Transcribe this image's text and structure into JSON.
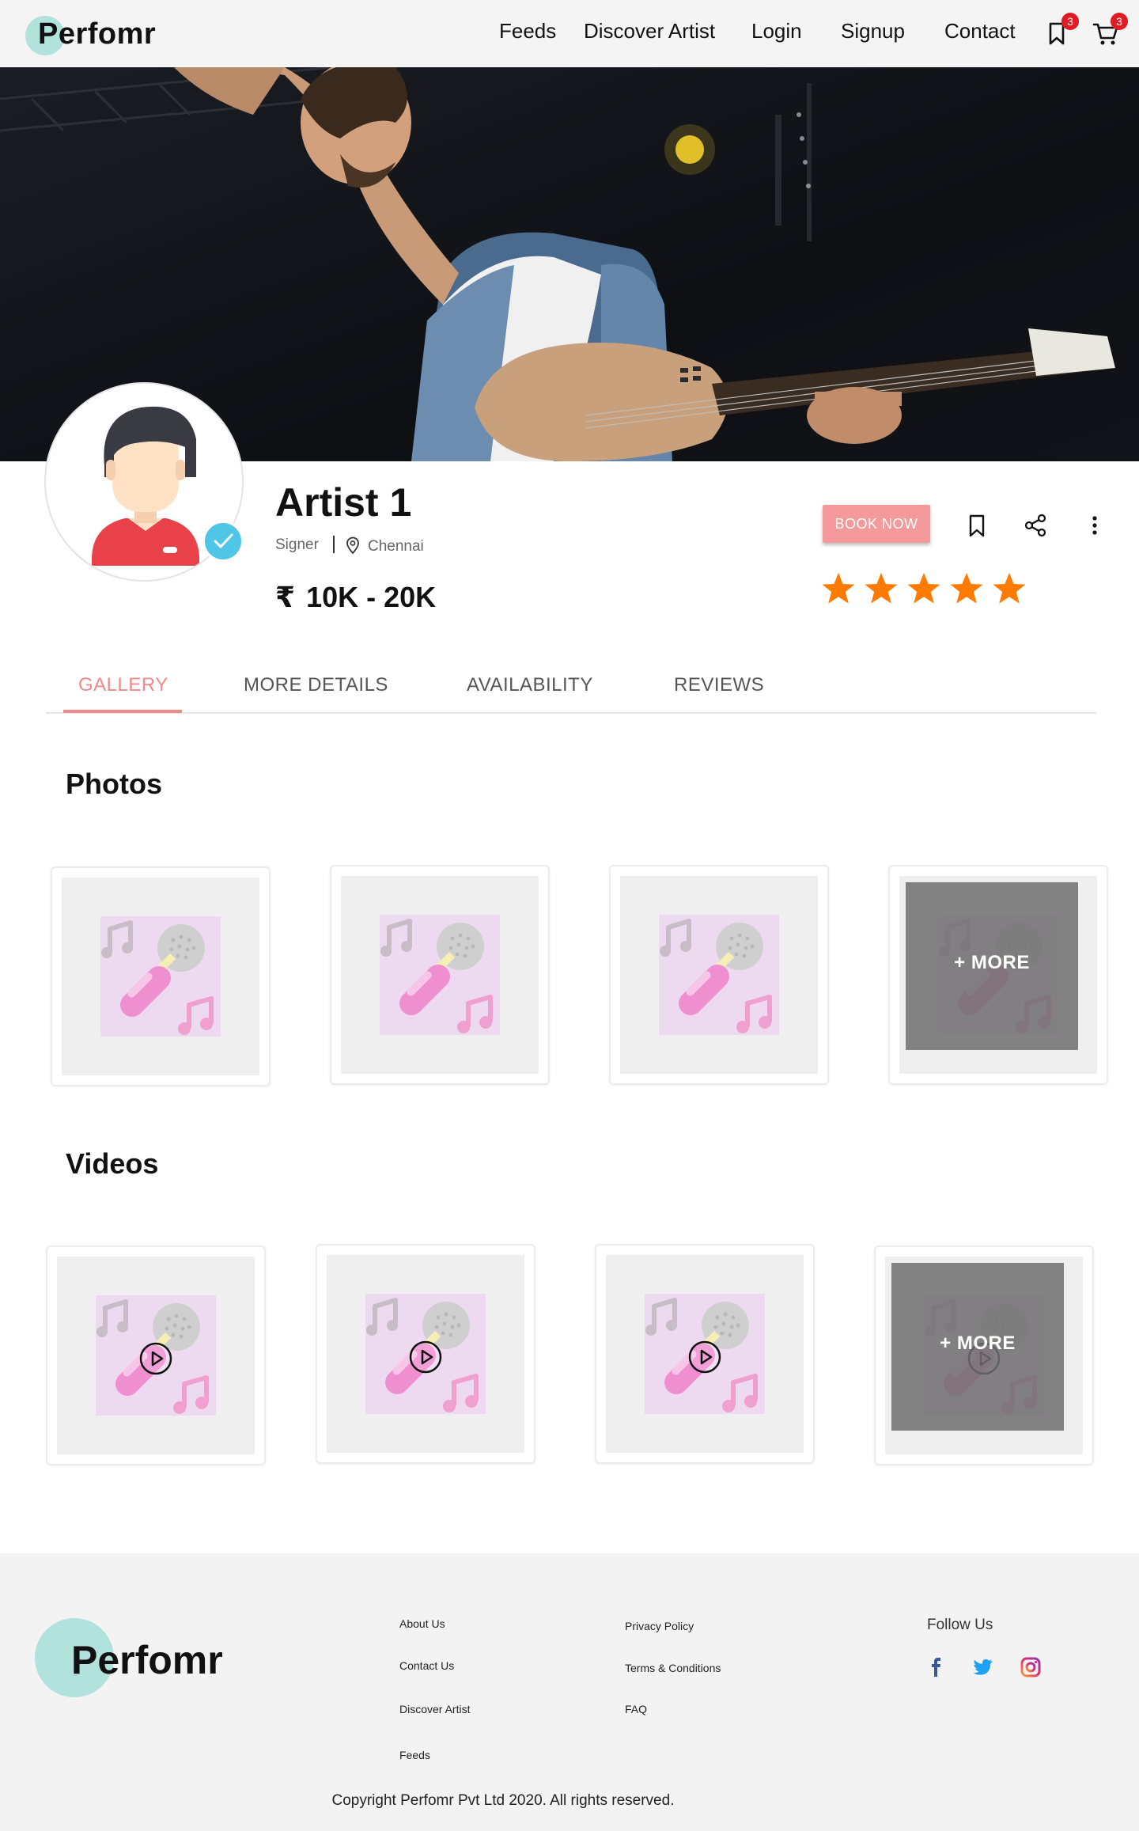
{
  "header": {
    "logo": "Perfomr",
    "nav": [
      "Feeds",
      "Discover Artist",
      "Login",
      "Signup",
      "Contact"
    ],
    "bookmark_count": "3",
    "cart_count": "3",
    "icons": [
      "bookmark-icon",
      "cart-icon"
    ]
  },
  "profile": {
    "name": "Artist 1",
    "role": "Signer",
    "city": "Chennai",
    "price": "10K - 20K",
    "currency_symbol": "₹",
    "rating": 5,
    "rating_max": 5,
    "book_label": "BOOK NOW",
    "verified": true,
    "colors": {
      "book": "#f49a9a",
      "star": "#ff7a00",
      "verified": "#4fc6e6"
    }
  },
  "tabs": {
    "items": [
      "GALLERY",
      "MORE DETAILS",
      "AVAILABILITY",
      "REVIEWS"
    ],
    "active": "GALLERY",
    "active_color": "#f08a8a"
  },
  "photos": {
    "title": "Photos",
    "more_label": "+ MORE"
  },
  "videos": {
    "title": "Videos",
    "more_label": "+ MORE"
  },
  "footer": {
    "logo": "Perfomr",
    "col1": [
      "About Us",
      "Contact Us",
      "Discover Artist",
      "Feeds"
    ],
    "col2": [
      "Privacy Policy",
      "Terms & Conditions",
      "FAQ"
    ],
    "follow_label": "Follow Us",
    "social": [
      "facebook-icon",
      "twitter-icon",
      "instagram-icon"
    ],
    "copyright": "Copyright Perfomr Pvt Ltd 2020. All rights reserved."
  }
}
